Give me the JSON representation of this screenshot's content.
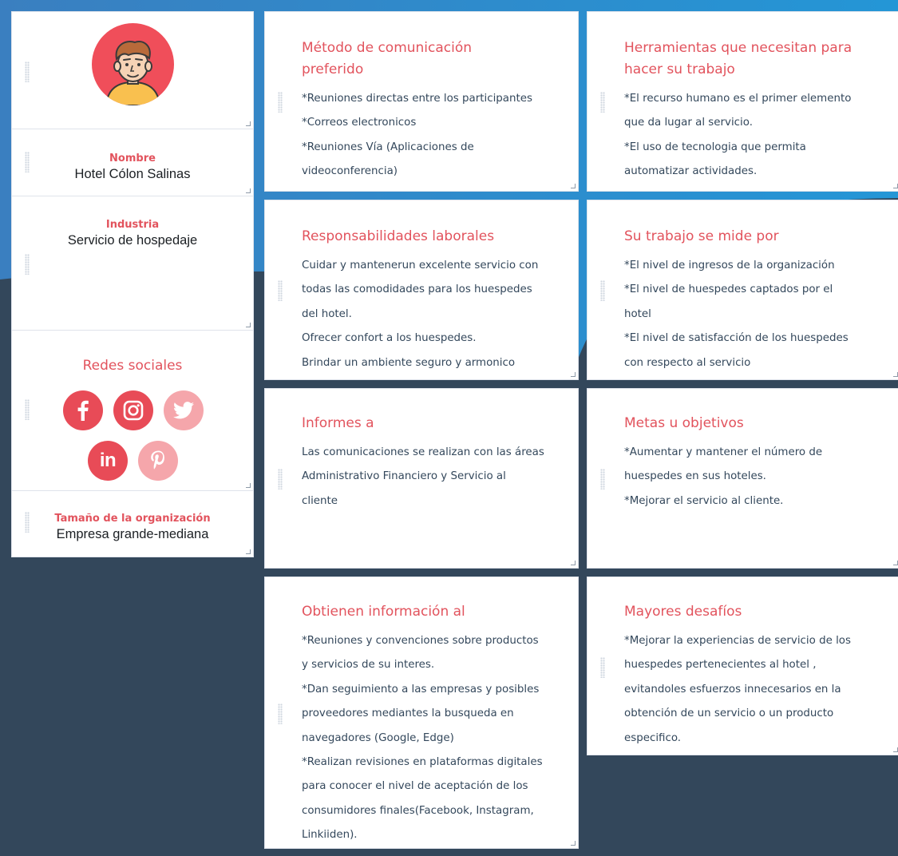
{
  "profile": {
    "name_label": "Nombre",
    "name_value": "Hotel Cólon Salinas",
    "industry_label": "Industria",
    "industry_value": "Servicio de hospedaje",
    "social_title": "Redes sociales",
    "social_icons": [
      "facebook-icon",
      "instagram-icon",
      "twitter-icon",
      "linkedin-icon",
      "pinterest-icon"
    ],
    "org_size_label": "Tamaño de la organización",
    "org_size_value": "Empresa grande-mediana"
  },
  "cards": {
    "comunicacion": {
      "title": [
        "Método de comunicación",
        "preferido"
      ],
      "lines": [
        "*Reuniones directas entre los participantes",
        "*Correos electronicos",
        "*Reuniones Vía (Aplicaciones de",
        "videoconferencia)"
      ]
    },
    "herramientas": {
      "title": [
        "Herramientas que necesitan para",
        "hacer su trabajo"
      ],
      "lines": [
        "*El recurso humano es el primer elemento",
        "que da lugar al servicio.",
        "*El uso de tecnologia que permita",
        "automatizar actividades."
      ]
    },
    "responsabilidades": {
      "title": [
        "Responsabilidades laborales"
      ],
      "lines": [
        "Cuidar y mantenerun excelente servicio con",
        "todas las comodidades para los huespedes",
        "del hotel.",
        "Ofrecer confort a los huespedes.",
        "Brindar un ambiente seguro y armonico"
      ]
    },
    "mide": {
      "title": [
        "Su trabajo se mide por"
      ],
      "lines": [
        "*El nivel de ingresos de la organización",
        "*El nivel de huespedes captados por el",
        "hotel",
        "*El nivel de satisfacción de los  huespedes",
        "con respecto al servicio"
      ]
    },
    "informes": {
      "title": [
        "Informes a"
      ],
      "lines": [
        "Las comunicaciones se realizan con las áreas",
        "Administrativo Financiero y Servicio al",
        "cliente"
      ]
    },
    "metas": {
      "title": [
        "Metas u objetivos"
      ],
      "lines": [
        "*Aumentar y mantener el número de",
        "huespedes en sus hoteles.",
        "*Mejorar el servicio al cliente."
      ]
    },
    "informacion": {
      "title": [
        "Obtienen información al"
      ],
      "lines": [
        "*Reuniones y convenciones sobre productos",
        "y servicios de su interes.",
        "*Dan seguimiento a las empresas y posibles",
        "proveedores mediantes la busqueda en",
        "navegadores (Google, Edge)",
        "*Realizan revisiones en plataformas digitales",
        "para conocer el nivel de aceptación de los",
        "consumidores finales(Facebook, Instagram,",
        "Linkiiden)."
      ]
    },
    "desafios": {
      "title": [
        "Mayores desafíos"
      ],
      "lines": [
        "*Mejorar la experiencias de servicio de los",
        "huespedes pertenecientes al hotel ,",
        "evitandoles esfuerzos innecesarios en la",
        "obtención de un servicio o un producto",
        "especifico."
      ]
    }
  },
  "colors": {
    "accent": "#e2535d",
    "background_dark": "#33475b",
    "background_blue": "#2f8fd1",
    "card": "#ffffff"
  }
}
